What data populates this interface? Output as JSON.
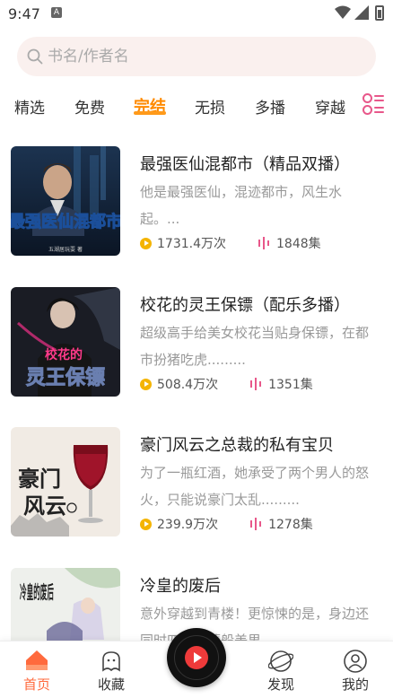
{
  "status_bar": {
    "time": "9:47"
  },
  "search": {
    "placeholder": "书名/作者名"
  },
  "tabs": [
    {
      "label": "精选",
      "active": false
    },
    {
      "label": "免费",
      "active": false
    },
    {
      "label": "完结",
      "active": true
    },
    {
      "label": "无损",
      "active": false
    },
    {
      "label": "多播",
      "active": false
    },
    {
      "label": "穿越",
      "active": false
    }
  ],
  "books": [
    {
      "title": "最强医仙混都市（精品双播）",
      "desc": "他是最强医仙，混迹都市，风生水起。...",
      "plays": "1731.4万次",
      "episodes": "1848集",
      "cover_text": "最强医仙混都市",
      "cover_credit": "五湖居玩耍 著"
    },
    {
      "title": "校花的灵王保镖（配乐多播）",
      "desc": "超级高手给美女校花当贴身保镖，在都市扮猪吃虎.........",
      "plays": "508.4万次",
      "episodes": "1351集",
      "cover_text_top": "校花的",
      "cover_text_bottom": "灵王保镖"
    },
    {
      "title": "豪门风云之总裁的私有宝贝",
      "desc": "为了一瓶红酒，她承受了两个男人的怒火，只能说豪门太乱.........",
      "plays": "239.9万次",
      "episodes": "1278集",
      "cover_text_a": "豪门",
      "cover_text_b": "风云"
    },
    {
      "title": "冷皇的废后",
      "desc": "意外穿越到青楼！更惊悚的是，身边还同时四个妖孽般美男",
      "cover_text": "冷皇的废后"
    }
  ],
  "bottom_nav": {
    "home": "首页",
    "favorites": "收藏",
    "discover": "发现",
    "mine": "我的"
  },
  "colors": {
    "accent": "#ff8a00",
    "nav_active": "#ff6a3d",
    "play_icon": "#f4b400",
    "episodes_icon": "#e8578a"
  }
}
